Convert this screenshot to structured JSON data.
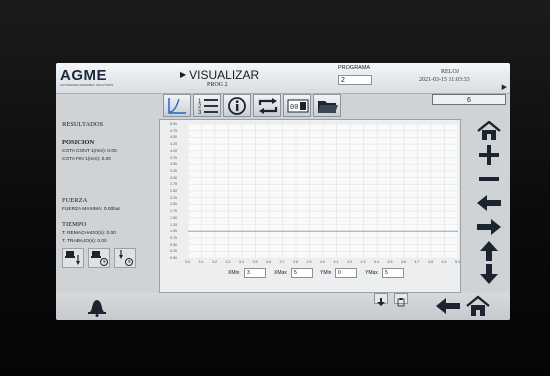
{
  "header": {
    "brand": "AGME",
    "tagline": "AUTOMATED ASSEMBLY SOLUTIONS",
    "title": "VISUALIZAR",
    "subtitle": "PROG 2",
    "programa_label": "PROGRAMA",
    "programa_value": "2",
    "reloj_label": "RELOJ",
    "reloj_value": "2021-03-15 11:03:33",
    "counter": "6"
  },
  "toolbar": [
    {
      "name": "chart-view-icon"
    },
    {
      "name": "list-numbered-icon"
    },
    {
      "name": "info-icon"
    },
    {
      "name": "swap-icon"
    },
    {
      "name": "counter-reset-icon"
    },
    {
      "name": "folder-icon"
    }
  ],
  "resultados": {
    "title": "RESULTADOS",
    "posicion_title": "POSICION",
    "cota_cont": "COTA CONT 1(mm): 0.00",
    "cota_fin": "COTA FIN 1(mm): 0.00",
    "fuerza_title": "FUERZA",
    "fuerza_maxima": "FUERZA MAXIMA: 0.00bar",
    "tiempo_title": "TIEMPO",
    "t_remachado": "T. REMACHADO(s): 0.00",
    "t_trabajo": "T. TRABAJO(s): 0.00"
  },
  "axis_inputs": {
    "xmin_label": "XMin",
    "xmin_value": "3",
    "xmax_label": "XMax",
    "xmax_value": "5",
    "ymin_label": "YMin",
    "ymin_value": "0",
    "ymax_label": "YMax",
    "ymax_value": "5"
  },
  "chart_data": {
    "type": "line",
    "x_ticks": [
      "3.0",
      "3.1",
      "3.2",
      "3.3",
      "3.4",
      "3.5",
      "3.6",
      "3.7",
      "3.8",
      "3.9",
      "4.0",
      "4.1",
      "4.2",
      "4.3",
      "4.4",
      "4.5",
      "4.6",
      "4.7",
      "4.8",
      "4.9",
      "5.0"
    ],
    "y_ticks": [
      "5.00",
      "4.75",
      "4.50",
      "4.25",
      "4.00",
      "3.75",
      "3.50",
      "3.25",
      "3.00",
      "2.75",
      "2.50",
      "2.25",
      "2.00",
      "1.75",
      "1.50",
      "1.25",
      "1.00",
      "0.75",
      "0.50",
      "0.25",
      "0.00"
    ],
    "xlim": [
      3,
      5
    ],
    "ylim": [
      0,
      5
    ],
    "grid": true,
    "series": [
      {
        "x": [
          3,
          5
        ],
        "y": [
          1,
          1
        ],
        "color": "#9aa3aa"
      }
    ]
  },
  "colors": {
    "screen_bg": "#cfd3d5",
    "plot_bg": "#fafafa",
    "grid": "#dde3e8",
    "icon_dark": "#2b3440",
    "accent_blue": "#2a62c9"
  },
  "right_buttons": [
    "home-icon",
    "plus-icon",
    "minus-icon",
    "arrow-left-icon",
    "arrow-right-icon",
    "arrow-up-icon",
    "arrow-down-icon"
  ],
  "bottom_buttons": [
    "bell-icon",
    "download-icon",
    "clipboard-icon",
    "back-arrow-icon",
    "home-icon"
  ]
}
